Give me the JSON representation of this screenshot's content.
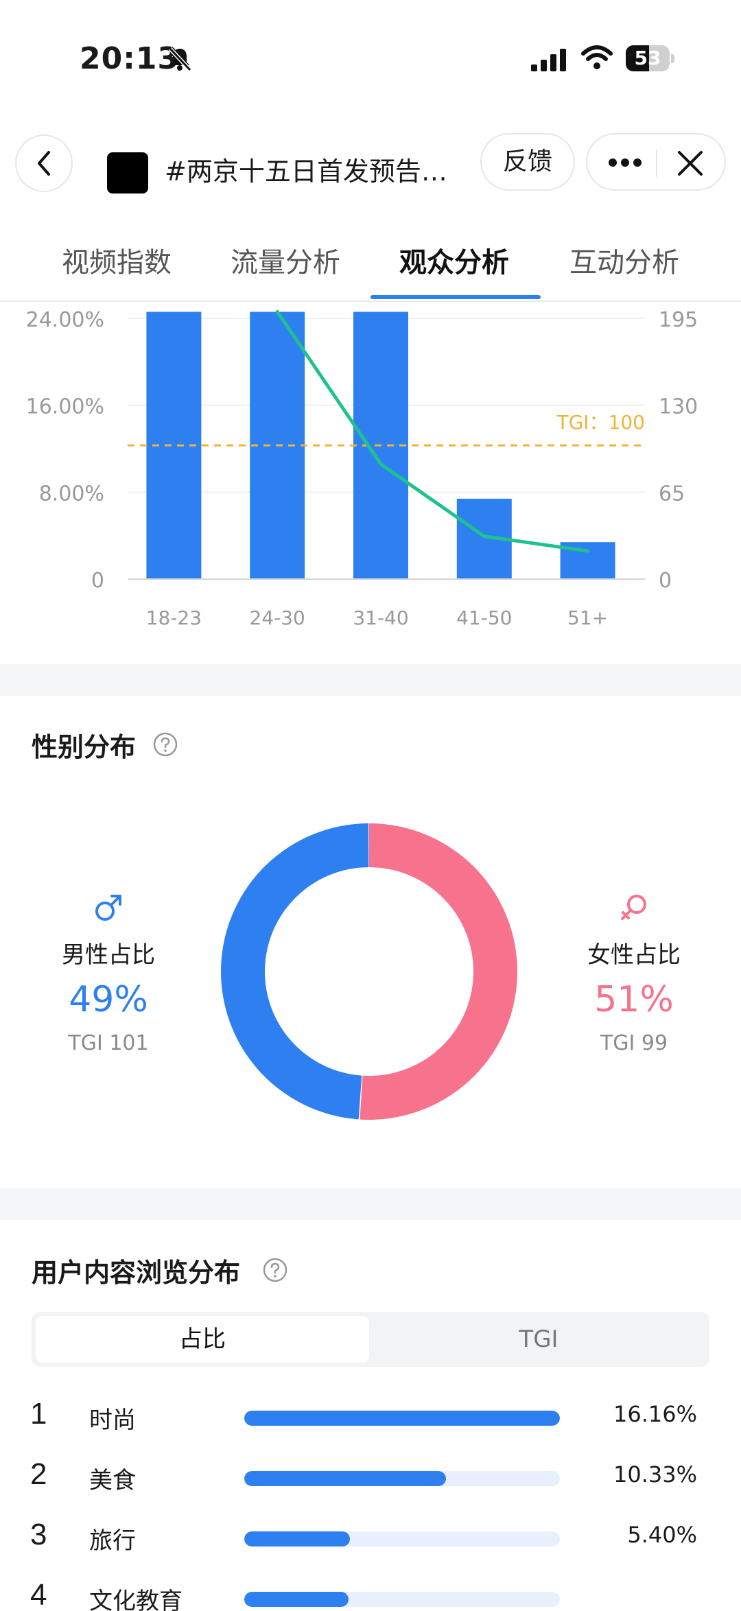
{
  "status": {
    "time": "20:13",
    "battery": "53",
    "battery_level": 0.53
  },
  "header": {
    "title": "#两京十五日首发预告…",
    "feedback": "反馈"
  },
  "tabs": [
    {
      "label": "视频指数",
      "active": false
    },
    {
      "label": "流量分析",
      "active": false
    },
    {
      "label": "观众分析",
      "active": true
    },
    {
      "label": "互动分析",
      "active": false
    }
  ],
  "chart_data": {
    "type": "bar",
    "categories": [
      "18-23",
      "24-30",
      "31-40",
      "41-50",
      "51+"
    ],
    "series": [
      {
        "type": "bar",
        "values": [
          24.6,
          24.6,
          24.6,
          7.4,
          3.4
        ],
        "axis": "left"
      },
      {
        "type": "line",
        "values": [
          null,
          200,
          86,
          32,
          21
        ],
        "axis": "right"
      }
    ],
    "left_ticks": [
      "0",
      "8.00%",
      "16.00%",
      "24.00%"
    ],
    "right_ticks": [
      "0",
      "65",
      "130",
      "195"
    ],
    "ylim_left": [
      0,
      24
    ],
    "ylim_right": [
      0,
      195
    ],
    "reference_line": {
      "label": "TGI：100",
      "value": 100
    },
    "colors": {
      "bar": "#2e80f0",
      "line": "#1fc28f",
      "reference": "#f0b33a"
    }
  },
  "gender": {
    "title": "性别分布",
    "male": {
      "label": "男性占比",
      "pct": "49%",
      "value": 49,
      "tgi": "TGI 101",
      "color": "#2e80f0"
    },
    "female": {
      "label": "女性占比",
      "pct": "51%",
      "value": 51,
      "tgi": "TGI 99",
      "color": "#f7728d"
    }
  },
  "browse": {
    "title": "用户内容浏览分布",
    "toggle": [
      "占比",
      "TGI"
    ],
    "items": [
      {
        "rank": "1",
        "label": "时尚",
        "value": "16.16%",
        "fraction": 1.0
      },
      {
        "rank": "2",
        "label": "美食",
        "value": "10.33%",
        "fraction": 0.64
      },
      {
        "rank": "3",
        "label": "旅行",
        "value": "5.40%",
        "fraction": 0.335
      },
      {
        "rank": "4",
        "label": "文化教育",
        "value": "",
        "fraction": 0.33
      }
    ]
  }
}
